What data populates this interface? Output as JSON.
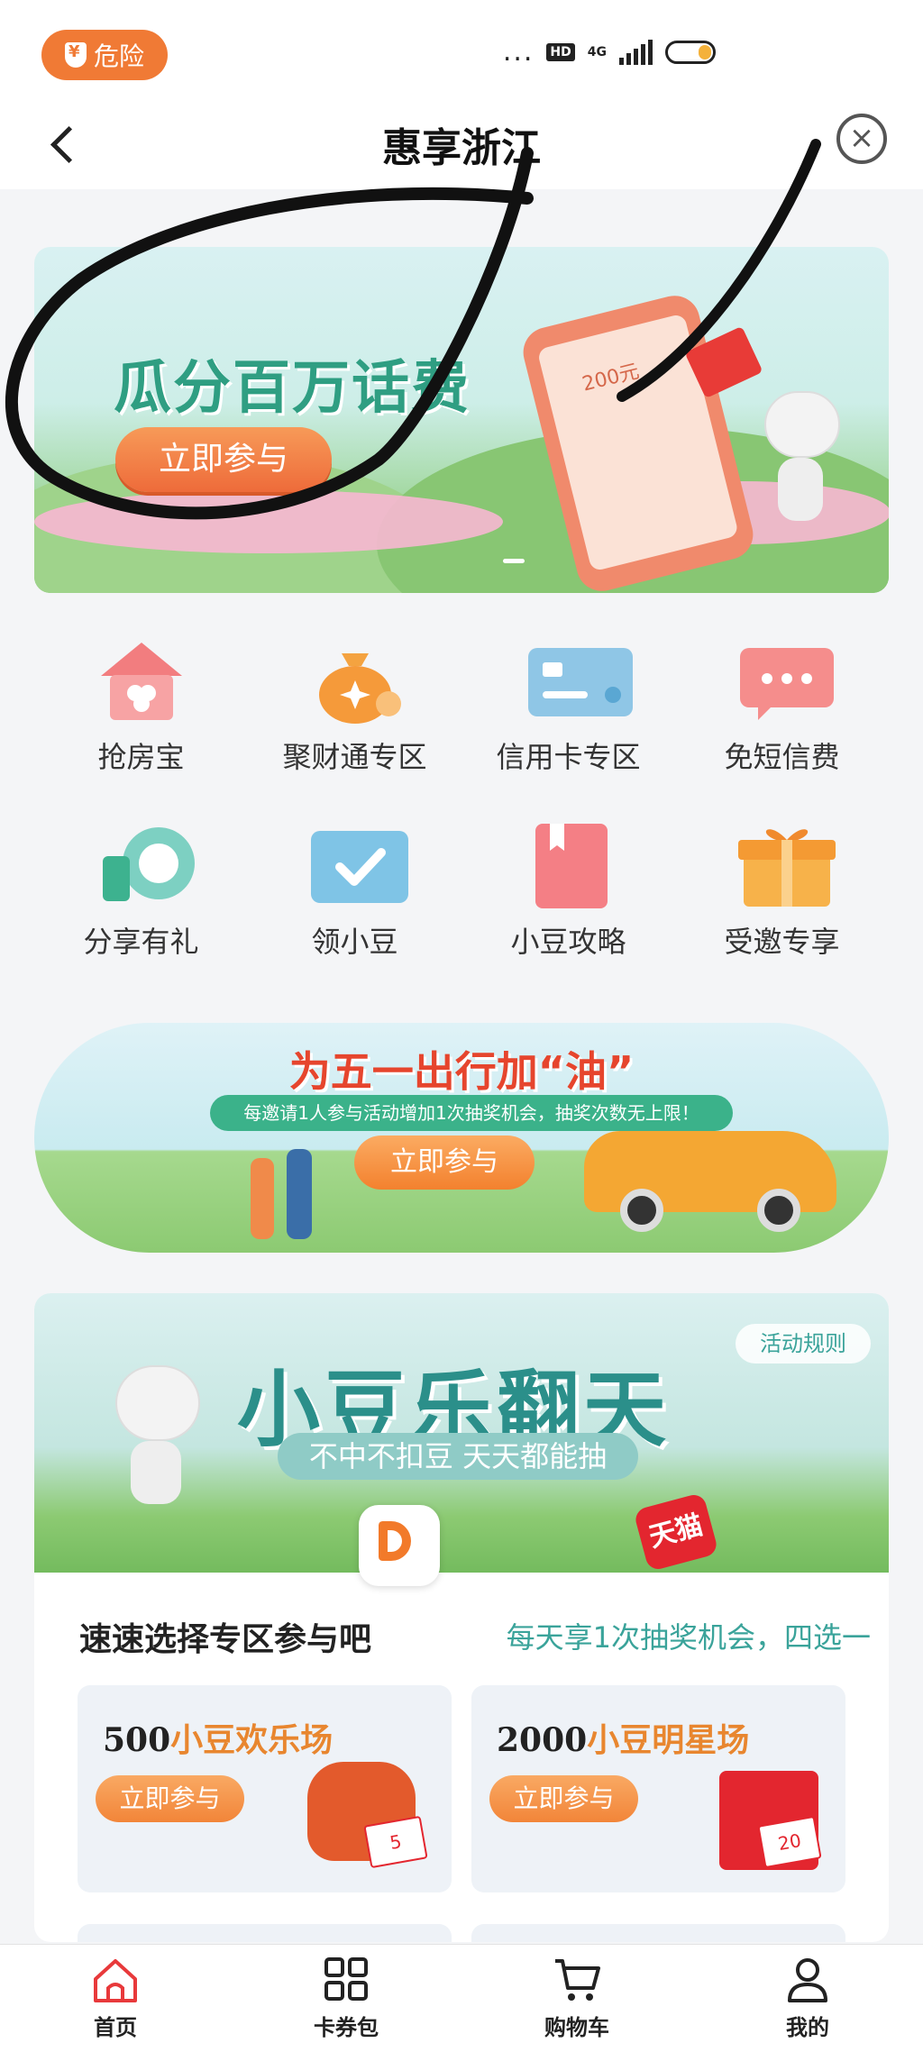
{
  "status_bar": {
    "risk_badge": "危险",
    "network": "4G",
    "hd": "HD",
    "dots": "..."
  },
  "nav": {
    "title": "惠享浙江"
  },
  "banner_top": {
    "title": "瓜分百万话费",
    "cta": "立即参与",
    "phone_amount": "200元"
  },
  "quick_grid_row1": [
    {
      "label": "抢房宝",
      "icon": "house-icon"
    },
    {
      "label": "聚财通专区",
      "icon": "money-bag-icon"
    },
    {
      "label": "信用卡专区",
      "icon": "credit-card-icon"
    },
    {
      "label": "免短信费",
      "icon": "message-icon"
    }
  ],
  "quick_grid_row2": [
    {
      "label": "分享有礼",
      "icon": "share-icon"
    },
    {
      "label": "领小豆",
      "icon": "checkbox-icon"
    },
    {
      "label": "小豆攻略",
      "icon": "book-icon"
    },
    {
      "label": "受邀专享",
      "icon": "gift-icon"
    }
  ],
  "banner_travel": {
    "title": "为五一出行加“油”",
    "subtitle": "每邀请1人参与活动增加1次抽奖机会，抽奖次数无上限！",
    "cta": "立即参与"
  },
  "lottery": {
    "title": "小豆乐翻天",
    "pill": "不中不扣豆 天天都能抽",
    "rules": "活动规则",
    "tmall": "天猫",
    "section_title": "速速选择专区参与吧",
    "section_hint": "每天享1次抽奖机会，四选一",
    "zones": [
      {
        "num": "500",
        "name": "小豆欢乐场",
        "cta": "立即参与",
        "ticket": "5"
      },
      {
        "num": "2000",
        "name": "小豆明星场",
        "cta": "立即参与",
        "ticket": "20"
      }
    ]
  },
  "tabbar": [
    {
      "label": "首页",
      "icon": "home-icon"
    },
    {
      "label": "卡券包",
      "icon": "grid-icon"
    },
    {
      "label": "购物车",
      "icon": "cart-icon"
    },
    {
      "label": "我的",
      "icon": "user-icon"
    }
  ],
  "colors": {
    "accent": "#f07a35",
    "teal": "#2b8f8a",
    "red": "#e3262f"
  }
}
